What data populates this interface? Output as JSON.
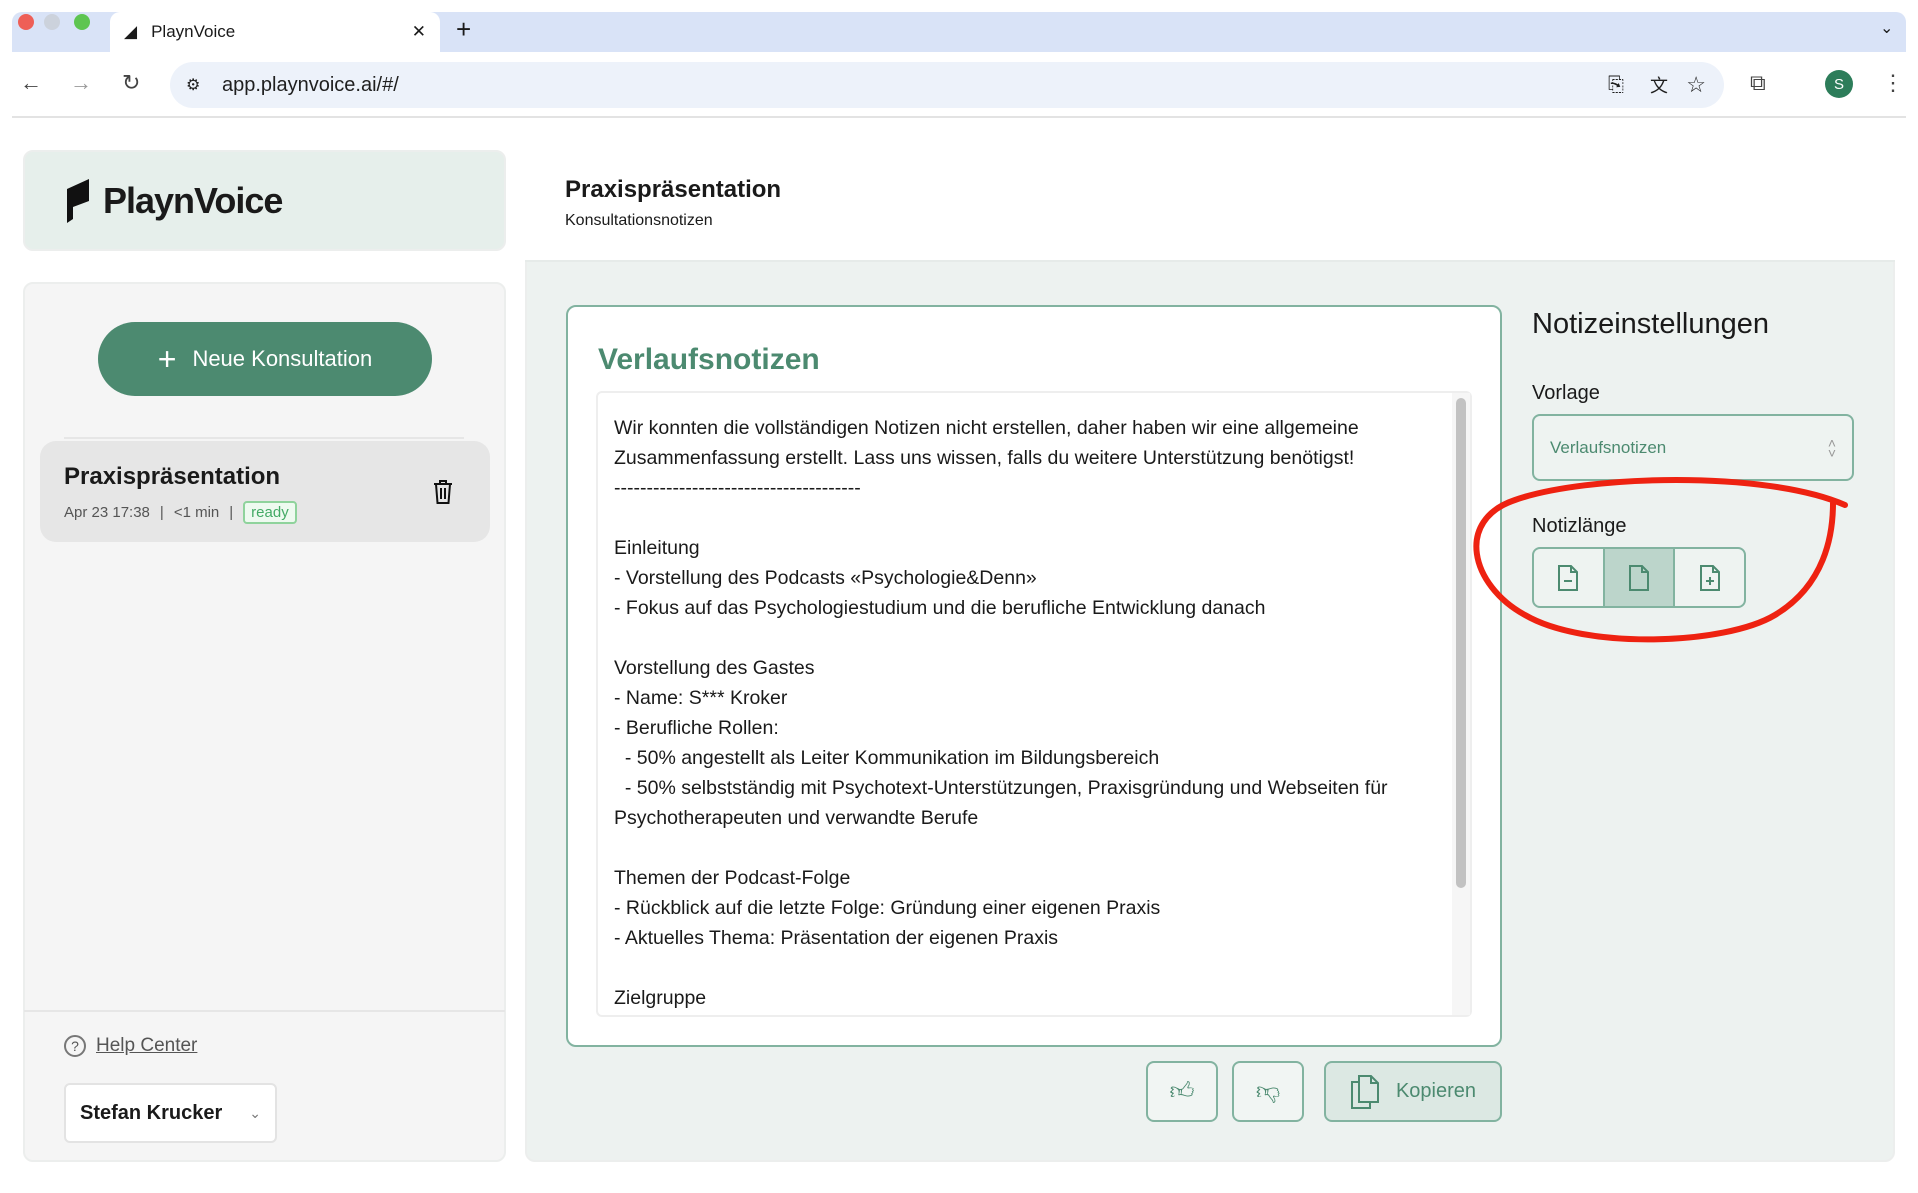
{
  "browser": {
    "tab_title": "PlaynVoice",
    "url": "app.playnvoice.ai/#/",
    "profile_initial": "S"
  },
  "sidebar": {
    "brand": "PlaynVoice",
    "new_button": "Neue Konsultation",
    "sessions": [
      {
        "title": "Praxispräsentation",
        "date": "Apr 23 17:38",
        "duration": "<1 min",
        "status": "ready"
      }
    ],
    "help_center": "Help Center",
    "user_name": "Stefan Krucker"
  },
  "header": {
    "title": "Praxispräsentation",
    "subtitle": "Konsultationsnotizen"
  },
  "notes": {
    "title": "Verlaufsnotizen",
    "content": "Wir konnten die vollständigen Notizen nicht erstellen, daher haben wir eine allgemeine Zusammenfassung erstellt. Lass uns wissen, falls du weitere Unterstützung benötigst!\n--------------------------------------\n\nEinleitung\n- Vorstellung des Podcasts «Psychologie&Denn»\n- Fokus auf das Psychologiestudium und die berufliche Entwicklung danach\n\nVorstellung des Gastes\n- Name: S*** Kroker\n- Berufliche Rollen:\n  - 50% angestellt als Leiter Kommunikation im Bildungsbereich\n  - 50% selbstständig mit Psychotext-Unterstützungen, Praxisgründung und Webseiten für Psychotherapeuten und verwandte Berufe\n\nThemen der Podcast-Folge\n- Rückblick auf die letzte Folge: Gründung einer eigenen Praxis\n- Aktuelles Thema: Präsentation der eigenen Praxis\n\nZielgruppe\n- Psychotherapeuten und verwandte Berufe, die eine eigene Praxis gründen",
    "copy_label": "Kopieren"
  },
  "settings": {
    "title": "Notizeinstellungen",
    "template_label": "Vorlage",
    "template_value": "Verlaufsnotizen",
    "length_label": "Notizlänge",
    "length_selected": "medium"
  },
  "colors": {
    "accent": "#4c8a70",
    "annotation": "#ee2211"
  }
}
